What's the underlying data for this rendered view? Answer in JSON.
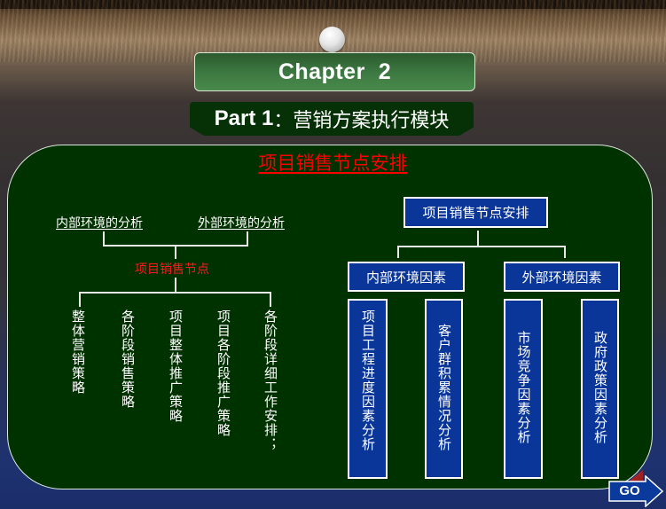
{
  "header": {
    "chapter": "Chapter  2",
    "part_prefix": "Part 1",
    "part_separator": "：",
    "part_title": "营销方案执行模块"
  },
  "panel": {
    "title": "项目销售节点安排"
  },
  "left_tree": {
    "top_nodes": [
      "内部环境的分析",
      "外部环境的分析"
    ],
    "center_node": "项目销售节点",
    "leaves": [
      "整体营销策略",
      "各阶段销售策略",
      "项目整体推广策略",
      "项目各阶段推广策略",
      "各阶段详细工作安排；"
    ]
  },
  "right_tree": {
    "root": "项目销售节点安排",
    "groups": [
      {
        "label": "内部环境因素",
        "children": [
          "项目工程进度因素分析",
          "客户群积累情况分析"
        ]
      },
      {
        "label": "外部环境因素",
        "children": [
          "市场竞争因素分析",
          "政府政策因素分析"
        ]
      }
    ]
  },
  "nav": {
    "go_label": "GO",
    "go_icon": "right-arrow-icon"
  },
  "colors": {
    "panel_bg": "#003200",
    "node_blue": "#0a3699",
    "title_red": "#ff0000",
    "chapter_green": "#3d7a42"
  }
}
